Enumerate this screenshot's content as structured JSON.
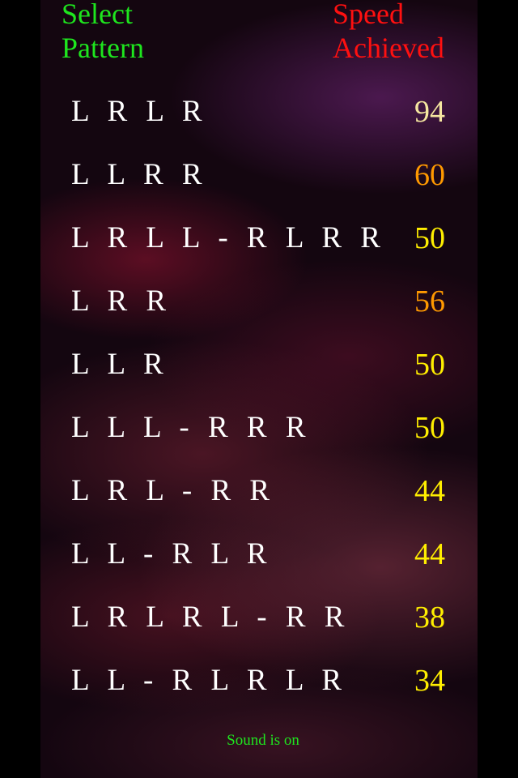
{
  "header": {
    "pattern_label": "Select\nPattern",
    "speed_label": "Speed\nAchieved"
  },
  "rows": [
    {
      "pattern": "L R L R",
      "speed": "94",
      "color": "#f5e6a0"
    },
    {
      "pattern": "L L R R",
      "speed": "60",
      "color": "#ff9900"
    },
    {
      "pattern": "L R L L - R L R R",
      "speed": "50",
      "color": "#ffee00"
    },
    {
      "pattern": "L R R",
      "speed": "56",
      "color": "#ff9900"
    },
    {
      "pattern": "L L R",
      "speed": "50",
      "color": "#ffee00"
    },
    {
      "pattern": "L L L - R R R",
      "speed": "50",
      "color": "#ffee00"
    },
    {
      "pattern": "L R L - R R",
      "speed": "44",
      "color": "#ffee00"
    },
    {
      "pattern": "L L - R L R",
      "speed": "44",
      "color": "#ffee00"
    },
    {
      "pattern": "L R L R L - R R",
      "speed": "38",
      "color": "#ffee00"
    },
    {
      "pattern": "L L - R L R L R",
      "speed": "34",
      "color": "#ffee00"
    }
  ],
  "footer": {
    "sound_status": "Sound is on"
  }
}
